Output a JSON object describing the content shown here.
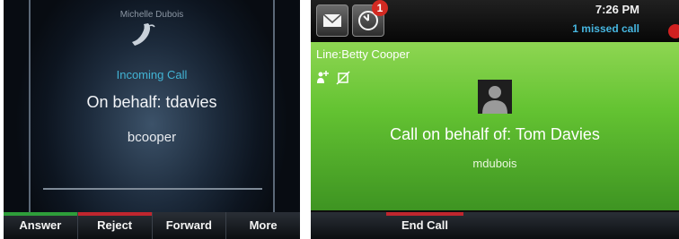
{
  "left_screen": {
    "caller_name": "Michelle Dubois",
    "status": "Incoming Call",
    "on_behalf": "On behalf: tdavies",
    "callee": "bcooper",
    "softkeys": [
      {
        "label": "Answer",
        "accent": "#2e9e3a"
      },
      {
        "label": "Reject",
        "accent": "#c0262e"
      },
      {
        "label": "Forward",
        "accent": ""
      },
      {
        "label": "More",
        "accent": ""
      }
    ]
  },
  "right_screen": {
    "status_bar": {
      "time": "7:26 PM",
      "missed_calls": "1 missed call",
      "badge_count": "1",
      "icons": [
        "envelope-icon",
        "clock-icon",
        "alert-icon"
      ]
    },
    "line": "Line:Betty Cooper",
    "call_on_behalf": "Call on behalf of: Tom Davies",
    "callee": "mdubois",
    "softkeys": [
      {
        "label": "End Call",
        "accent": "#c0262e"
      }
    ]
  },
  "colors": {
    "accent_blue": "#42b3d4",
    "call_green": "#64c332",
    "answer_green": "#2e9e3a",
    "reject_red": "#c0262e"
  }
}
